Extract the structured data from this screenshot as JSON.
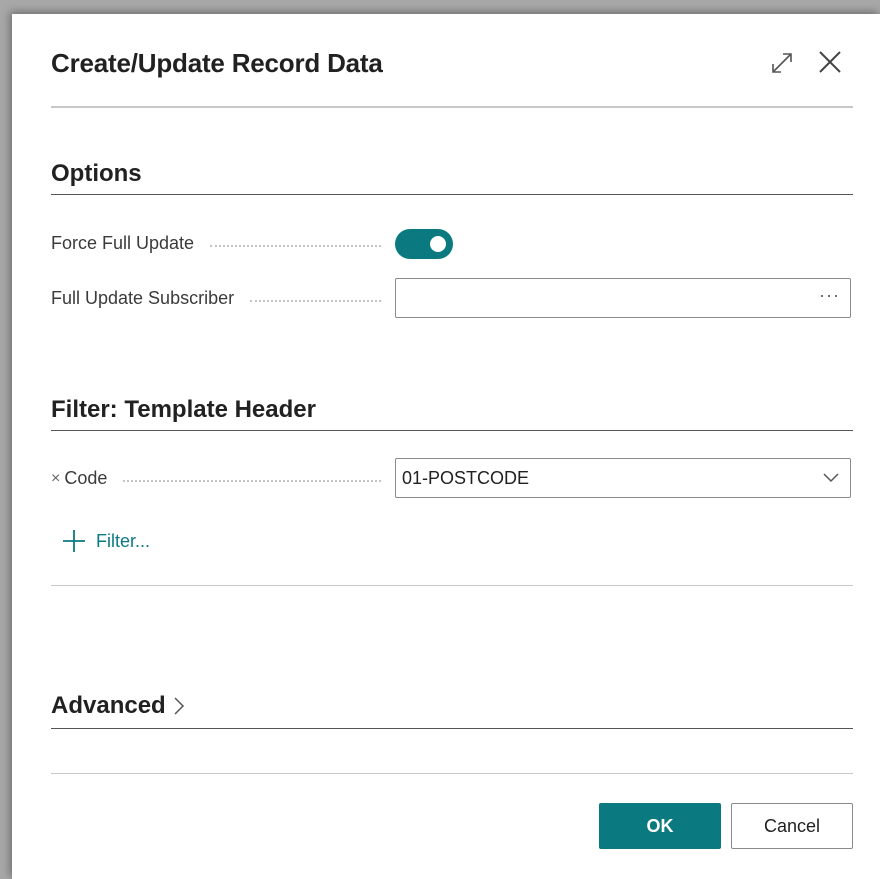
{
  "dialog": {
    "title": "Create/Update Record Data",
    "expand_icon": "expand-icon",
    "close_icon": "close-icon"
  },
  "options": {
    "heading": "Options",
    "force_full_update": {
      "label": "Force Full Update",
      "value": true
    },
    "full_update_subscriber": {
      "label": "Full Update Subscriber",
      "value": "",
      "lookup_label": "···"
    }
  },
  "filter": {
    "heading": "Filter: Template Header",
    "code": {
      "remove_label": "×",
      "label": "Code",
      "value": "01-POSTCODE"
    },
    "add_filter_label": "Filter..."
  },
  "advanced": {
    "heading": "Advanced"
  },
  "buttons": {
    "ok": "OK",
    "cancel": "Cancel"
  },
  "colors": {
    "accent": "#0a7a80"
  }
}
